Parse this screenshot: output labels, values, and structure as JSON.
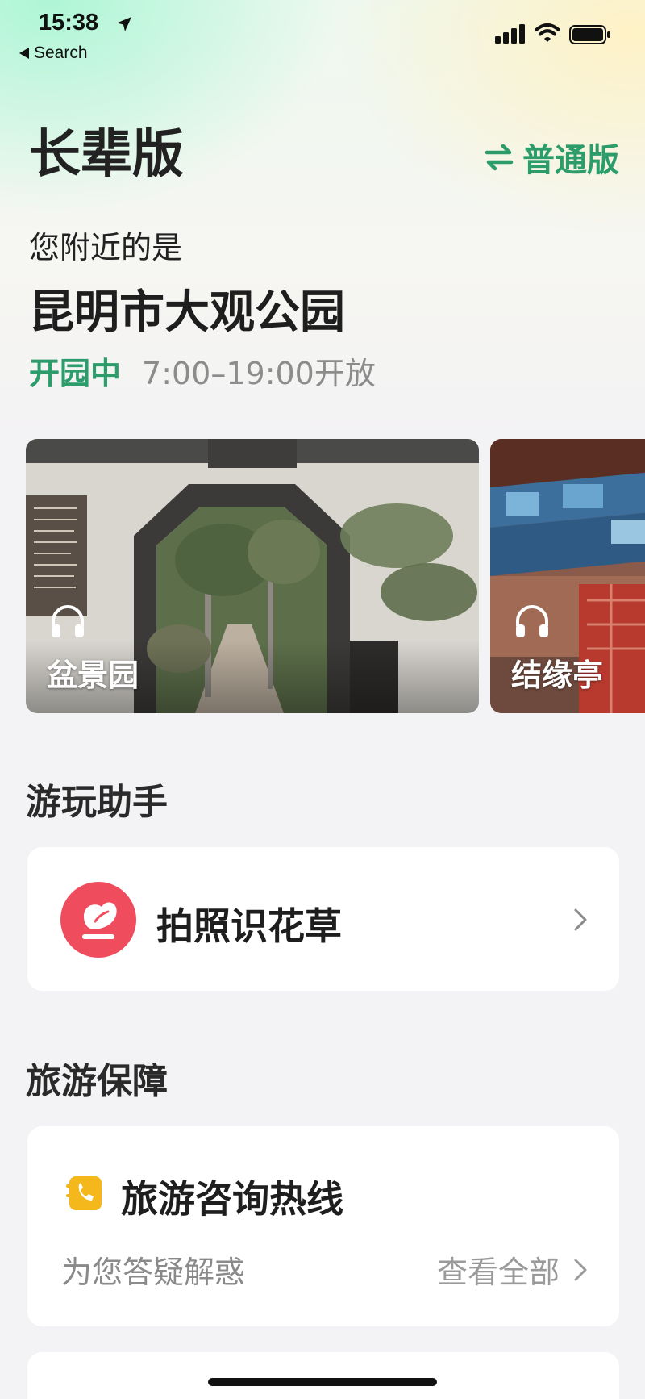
{
  "status_bar": {
    "time": "15:38",
    "back_label": "Search"
  },
  "header": {
    "title": "长辈版",
    "switch_label": "普通版"
  },
  "location": {
    "nearby_label": "您附近的是",
    "place_name": "昆明市大观公园",
    "open_status": "开园中",
    "hours": "7:00–19:00开放"
  },
  "cards": [
    {
      "label": "盆景园",
      "icon": "headphones-icon"
    },
    {
      "label": "结缘亭",
      "icon": "headphones-icon"
    }
  ],
  "sections": {
    "play_assistant": {
      "title": "游玩助手",
      "items": [
        {
          "label": "拍照识花草",
          "icon": "flower-camera-icon"
        }
      ]
    },
    "travel_guarantee": {
      "title": "旅游保障",
      "hotline": {
        "title": "旅游咨询热线",
        "subtitle": "为您答疑解惑",
        "link_label": "查看全部",
        "icon": "phone-icon"
      }
    }
  },
  "colors": {
    "accent": "#2c9c6a",
    "plant_icon_bg": "#ef4d5d",
    "hotline_icon": "#f4b81c"
  }
}
